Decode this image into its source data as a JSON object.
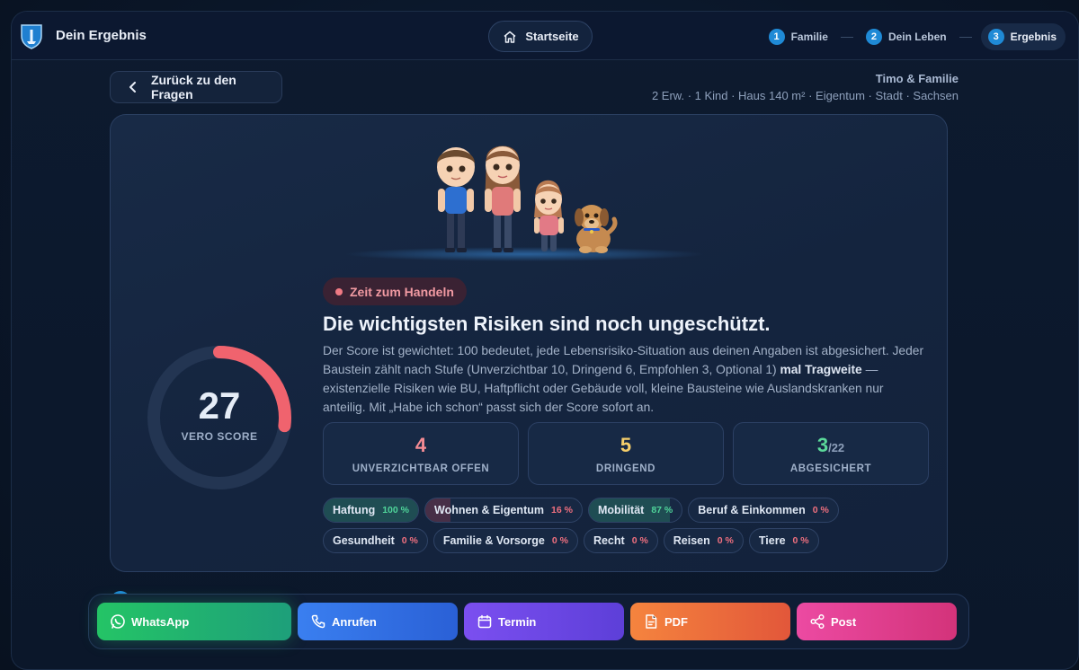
{
  "header": {
    "title": "Dein Ergebnis",
    "home_label": "Startseite",
    "steps": [
      {
        "num": "1",
        "label": "Familie"
      },
      {
        "num": "2",
        "label": "Dein Leben"
      },
      {
        "num": "3",
        "label": "Ergebnis"
      }
    ]
  },
  "nav": {
    "back_label": "Zurück zu den Fragen"
  },
  "profile": {
    "name": "Timo & Familie",
    "details": "2 Erw. · 1 Kind · Haus 140 m² · Eigentum · Stadt · Sachsen"
  },
  "score": {
    "value": "27",
    "value_fraction": 0.27,
    "label": "VERO SCORE"
  },
  "result": {
    "status": "Zeit zum Handeln",
    "headline": "Die wichtigsten Risiken sind noch ungeschützt.",
    "desc_part1": "Der Score ist gewichtet: 100 bedeutet, jede Lebensrisiko-Situation aus deinen Angaben ist abgesichert. Jeder Baustein zählt nach Stufe (Unverzichtbar 10, Dringend 6, Empfohlen 3, Optional 1) ",
    "desc_bold": "mal Tragweite",
    "desc_part2": " — existenzielle Risiken wie BU, Haftpflicht oder Gebäude voll, kleine Bausteine wie Auslandskranken nur anteilig. Mit „Habe ich schon“ passt sich der Score sofort an."
  },
  "metrics": [
    {
      "value": "4",
      "suffix": "",
      "label": "UNVERZICHTBAR OFFEN",
      "color": "#f38b94"
    },
    {
      "value": "5",
      "suffix": "",
      "label": "DRINGEND",
      "color": "#f6cf6a"
    },
    {
      "value": "3",
      "suffix": "/22",
      "label": "ABGESICHERT",
      "color": "#5bd99a"
    }
  ],
  "categories": [
    {
      "label": "Haftung",
      "pct": "100 %",
      "level": 1.0
    },
    {
      "label": "Wohnen & Eigentum",
      "pct": "16 %",
      "level": 0.16
    },
    {
      "label": "Mobilität",
      "pct": "87 %",
      "level": 0.87
    },
    {
      "label": "Beruf & Einkommen",
      "pct": "0 %",
      "level": 0
    },
    {
      "label": "Gesundheit",
      "pct": "0 %",
      "level": 0
    },
    {
      "label": "Familie & Vorsorge",
      "pct": "0 %",
      "level": 0
    },
    {
      "label": "Recht",
      "pct": "0 %",
      "level": 0
    },
    {
      "label": "Reisen",
      "pct": "0 %",
      "level": 0
    },
    {
      "label": "Tiere",
      "pct": "0 %",
      "level": 0
    }
  ],
  "actions": {
    "whatsapp": "WhatsApp",
    "call": "Anrufen",
    "termin": "Termin",
    "pdf": "PDF",
    "post": "Post"
  },
  "colors": {
    "accent": "#1f8ad6",
    "gauge": "#f0636e",
    "good": "#4fd49a",
    "bad": "#f0707f"
  }
}
